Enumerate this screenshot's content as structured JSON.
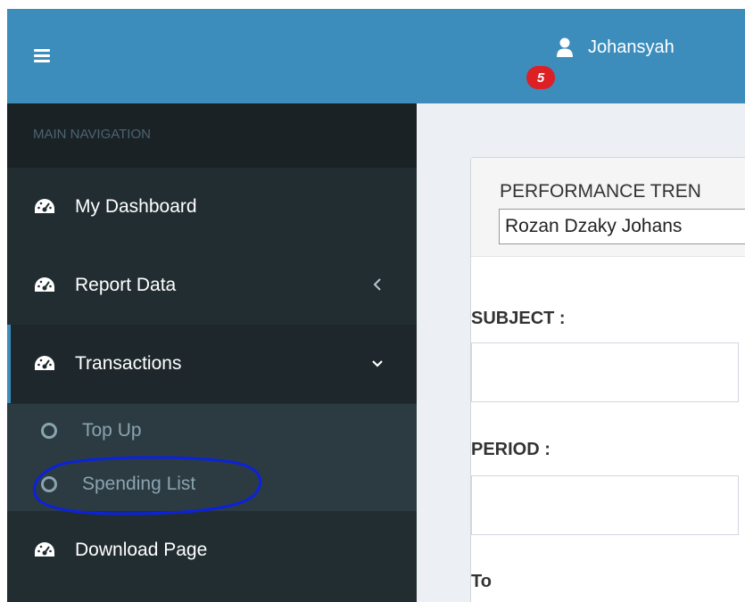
{
  "header": {
    "user_name": "Johansyah",
    "notification_count": "5"
  },
  "sidebar": {
    "nav_header": "MAIN NAVIGATION",
    "items": [
      {
        "label": "My Dashboard"
      },
      {
        "label": "Report Data"
      },
      {
        "label": "Transactions"
      },
      {
        "label": "Download Page"
      }
    ],
    "submenu": [
      {
        "label": "Top Up"
      },
      {
        "label": "Spending List"
      }
    ]
  },
  "main": {
    "panel_title": "PERFORMANCE TREN",
    "employee_select": "Rozan Dzaky Johans",
    "subject_label": "SUBJECT :",
    "period_label": "PERIOD :",
    "to_label": "To"
  },
  "colors": {
    "header_bg": "#3c8dbc",
    "sidebar_bg": "#222d32",
    "badge": "#dd1f26",
    "annotation": "#0a22e0"
  },
  "icons": {
    "menu": "hamburger-icon",
    "user": "user-icon",
    "dashboard": "dashboard-icon",
    "collapse": "chevron-left-icon",
    "expand": "chevron-down-icon",
    "submenu_bullet": "circle-icon"
  }
}
